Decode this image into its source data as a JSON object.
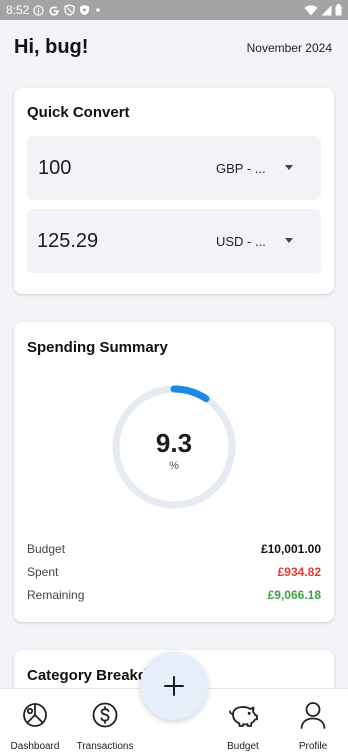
{
  "status_bar": {
    "time": "8:52",
    "icons": [
      "info-icon",
      "google-icon",
      "vpn-shield-icon",
      "shield-icon",
      "dot-icon"
    ],
    "right_icons": [
      "wifi-icon",
      "signal-icon",
      "battery-icon"
    ]
  },
  "header": {
    "greeting": "Hi, bug!",
    "month": "November 2024"
  },
  "quick_convert": {
    "title": "Quick Convert",
    "rows": [
      {
        "amount": "100",
        "currency": "GBP - ..."
      },
      {
        "amount": "125.29",
        "currency": "USD - ..."
      }
    ]
  },
  "spending_summary": {
    "title": "Spending Summary",
    "percent": "9.3",
    "percent_unit": "%",
    "progress_fraction": 0.093,
    "stats": [
      {
        "label": "Budget",
        "value": "£10,001.00",
        "color": "#111111"
      },
      {
        "label": "Spent",
        "value": "£934.82",
        "color": "#e53935"
      },
      {
        "label": "Remaining",
        "value": "£9,066.18",
        "color": "#43a047"
      }
    ]
  },
  "category_breakdown": {
    "title": "Category Breakd"
  },
  "fab": {
    "icon": "plus-icon"
  },
  "nav": [
    {
      "label": "Dashboard",
      "icon": "dashboard-icon"
    },
    {
      "label": "Transactions",
      "icon": "dollar-icon"
    },
    {
      "label": "Budget",
      "icon": "piggy-bank-icon"
    },
    {
      "label": "Profile",
      "icon": "user-icon"
    }
  ],
  "colors": {
    "accent": "#1e88e5",
    "ring_track": "#e6ebf1",
    "fab_bg": "#e6eef9"
  }
}
